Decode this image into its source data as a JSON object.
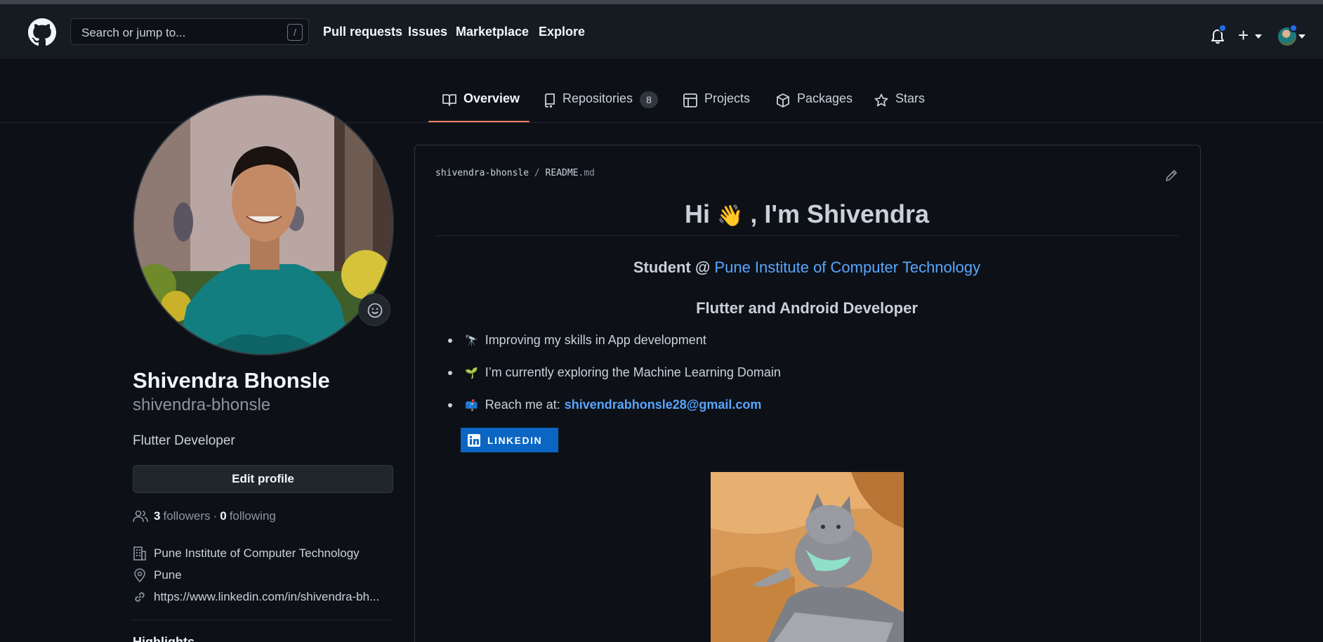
{
  "header": {
    "search_placeholder": "Search or jump to...",
    "search_key": "/",
    "nav": [
      "Pull requests",
      "Issues",
      "Marketplace",
      "Explore"
    ],
    "icons": [
      "github-mark-icon",
      "bell-icon",
      "plus-icon",
      "avatar"
    ]
  },
  "tabs": [
    {
      "label": "Overview",
      "icon": "book-icon",
      "active": true
    },
    {
      "label": "Repositories",
      "icon": "repo-icon",
      "count": "8"
    },
    {
      "label": "Projects",
      "icon": "table-icon"
    },
    {
      "label": "Packages",
      "icon": "package-icon"
    },
    {
      "label": "Stars",
      "icon": "star-icon"
    }
  ],
  "profile": {
    "full_name": "Shivendra Bhonsle",
    "username": "shivendra-bhonsle",
    "bio": "Flutter Developer",
    "edit_button": "Edit profile",
    "followers_count": "3",
    "followers_label": "followers",
    "separator": "·",
    "following_count": "0",
    "following_label": "following",
    "organization": "Pune Institute of Computer Technology",
    "location": "Pune",
    "website": "https://www.linkedin.com/in/shivendra-bh...",
    "section_peek": "Highlights"
  },
  "readme": {
    "path_user": "shivendra-bhonsle",
    "path_sep": "/",
    "path_file": "README",
    "path_ext": ".md",
    "title_pre": "Hi",
    "title_emoji": "👋",
    "title_post": ", I'm Shivendra",
    "student_prefix": "Student @",
    "college_link": "Pune Institute of Computer Technology",
    "role": "Flutter and Android Developer",
    "bullets": [
      {
        "emoji": "🔭",
        "text": "Improving my skills in App development"
      },
      {
        "emoji": "🌱",
        "text": "I’m currently exploring the Machine Learning Domain"
      },
      {
        "emoji": "📫",
        "text": "Reach me at:",
        "link": "shivendrabhonsle28@gmail.com"
      }
    ],
    "badge_label": "LINKEDIN"
  },
  "colors": {
    "bg": "#0d1117",
    "header_bg": "#161b22",
    "border": "#30363d",
    "link": "#58a6ff",
    "tab_accent": "#f78166",
    "linkedin": "#0a66c2"
  }
}
